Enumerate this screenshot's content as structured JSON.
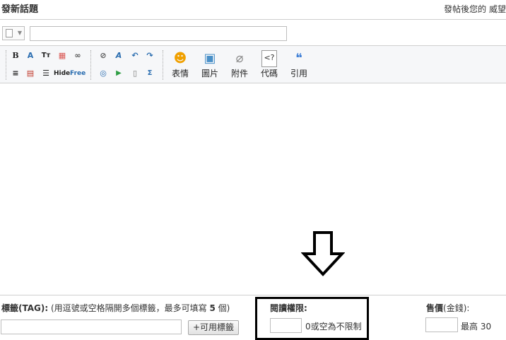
{
  "header": {
    "title": "發新話題",
    "right_note": "發帖後您的 威望"
  },
  "subject": {
    "value": "",
    "type_value": ""
  },
  "toolbar": {
    "small_buttons": [
      {
        "name": "bold-icon",
        "glyph": "B"
      },
      {
        "name": "font-icon",
        "glyph": "A"
      },
      {
        "name": "font-size-icon",
        "glyph": "Tт"
      },
      {
        "name": "color-icon",
        "glyph": "▦"
      },
      {
        "name": "link-icon",
        "glyph": "∞"
      },
      {
        "name": "unlink-icon",
        "glyph": "⊘"
      },
      {
        "name": "clear-format-icon",
        "glyph": "A"
      },
      {
        "name": "undo-icon",
        "glyph": "↶"
      },
      {
        "name": "redo-icon",
        "glyph": "↷"
      },
      {
        "name": "align-icon",
        "glyph": "≡"
      },
      {
        "name": "attach-list-icon",
        "glyph": "▤"
      },
      {
        "name": "list-icon",
        "glyph": "☰"
      },
      {
        "name": "hide-icon",
        "glyph": "Hide"
      },
      {
        "name": "free-icon",
        "glyph": "Free"
      },
      {
        "name": "media-icon",
        "glyph": "◎"
      },
      {
        "name": "flash-icon",
        "glyph": "▶"
      },
      {
        "name": "page-icon",
        "glyph": "▯"
      },
      {
        "name": "formula-icon",
        "glyph": "Σ"
      }
    ],
    "big_buttons": [
      {
        "name": "smiley-button",
        "label": "表情",
        "glyph": "☻"
      },
      {
        "name": "image-button",
        "label": "圖片",
        "glyph": "▣"
      },
      {
        "name": "attachment-button",
        "label": "附件",
        "glyph": "⌀"
      },
      {
        "name": "code-button",
        "label": "代碼",
        "glyph": "<?"
      },
      {
        "name": "quote-button",
        "label": "引用",
        "glyph": "❝"
      }
    ]
  },
  "tags": {
    "label_bold": "標籤(TAG):",
    "label_hint": " (用逗號或空格隔開多個標籤，最多可填寫 ",
    "label_count": "5",
    "label_tail": " 個)",
    "value": "",
    "button": "+可用標籤"
  },
  "read_permission": {
    "label": "閱讀權限:",
    "value": "",
    "hint": "0或空為不限制"
  },
  "price": {
    "label_bold": "售價",
    "label_tail": "(金錢):",
    "value": "",
    "max": "最高 30"
  },
  "colors": {
    "accent_border": "#000000",
    "toolbar_bg": "#f6f7f9"
  }
}
